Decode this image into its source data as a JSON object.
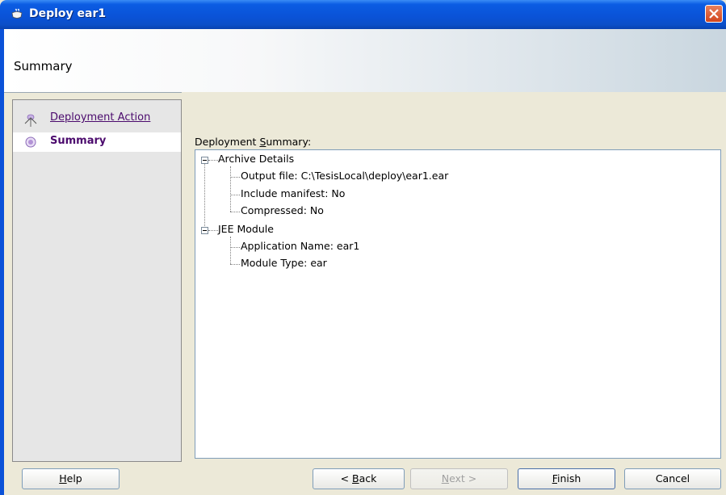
{
  "window": {
    "title": "Deploy ear1"
  },
  "header": {
    "title": "Summary"
  },
  "nav": {
    "items": [
      {
        "label": "Deployment Action",
        "selected": false
      },
      {
        "label": "Summary",
        "selected": true
      }
    ]
  },
  "main": {
    "summary_label_prefix": "Deployment ",
    "summary_label_mnemonic": "S",
    "summary_label_suffix": "ummary:",
    "tree": [
      {
        "label": "Archive Details",
        "children": [
          "Output file: C:\\TesisLocal\\deploy\\ear1.ear",
          "Include manifest: No",
          "Compressed: No"
        ]
      },
      {
        "label": "JEE Module",
        "children": [
          "Application Name: ear1",
          "Module Type: ear"
        ]
      }
    ]
  },
  "buttons": {
    "help": {
      "mn": "H",
      "rest": "elp"
    },
    "back": {
      "pre": "< ",
      "mn": "B",
      "rest": "ack"
    },
    "next": {
      "mn": "N",
      "rest": "ext >"
    },
    "finish": {
      "mn": "F",
      "rest": "inish"
    },
    "cancel": {
      "label": "Cancel"
    }
  },
  "colors": {
    "titlebar": "#0a52d6",
    "nav_text": "#4b0a6d",
    "close": "#d2451c"
  },
  "icons": {
    "title": "coffee-cup-icon",
    "close": "close-icon",
    "nav_done": "step-done-icon",
    "nav_current": "step-current-icon"
  }
}
